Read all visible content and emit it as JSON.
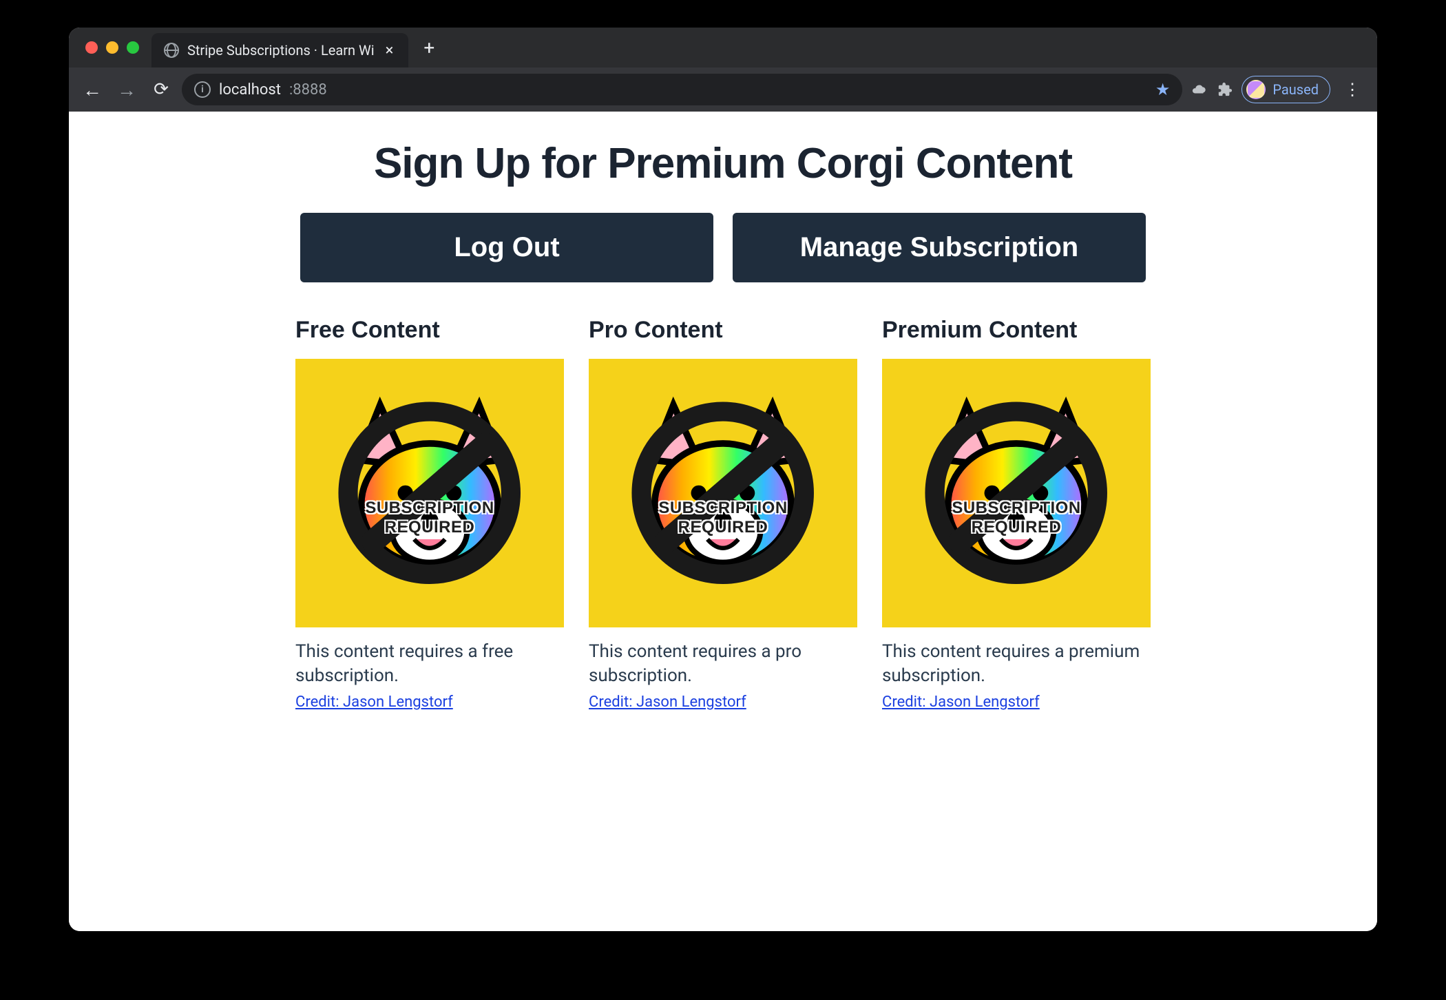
{
  "browser": {
    "tab_title": "Stripe Subscriptions · Learn Wi",
    "url_host": "localhost",
    "url_port": ":8888",
    "profile_status": "Paused"
  },
  "page": {
    "heading": "Sign Up for Premium Corgi Content",
    "buttons": {
      "logout": "Log Out",
      "manage": "Manage Subscription"
    },
    "subscription_required_label": "SUBSCRIPTION REQUIRED",
    "cards": [
      {
        "title": "Free Content",
        "desc": "This content requires a free subscription.",
        "credit": "Credit: Jason Lengstorf"
      },
      {
        "title": "Pro Content",
        "desc": "This content requires a pro subscription.",
        "credit": "Credit: Jason Lengstorf"
      },
      {
        "title": "Premium Content",
        "desc": "This content requires a premium subscription.",
        "credit": "Credit: Jason Lengstorf"
      }
    ]
  }
}
